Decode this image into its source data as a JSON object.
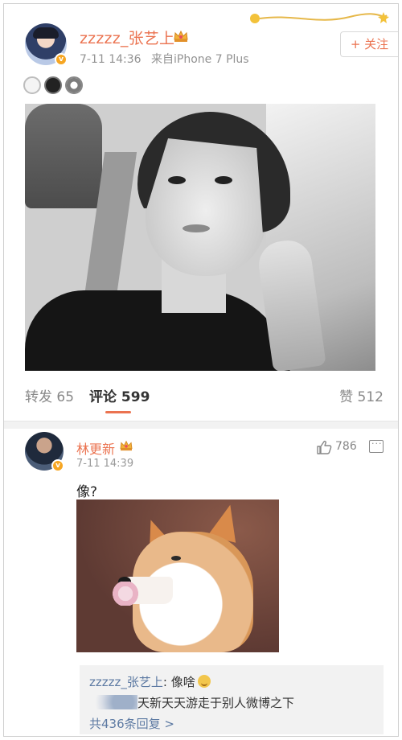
{
  "post": {
    "username": "zzzzz_张艺上",
    "time": "7-11 14:36",
    "source": "来自iPhone 7 Plus",
    "follow_label": "+ 关注"
  },
  "tabs": {
    "repost": "转发 65",
    "comment": "评论 599",
    "like": "赞 512"
  },
  "comment": {
    "username": "林更新",
    "time": "7-11 14:39",
    "likes": "786",
    "text": "像?"
  },
  "replies": {
    "reply1_name": "zzzzz_张艺上",
    "reply1_text": ": 像啥",
    "reply2_text": "天新天天游走于别人微博之下",
    "more": "共436条回复 >"
  },
  "icons": {
    "verified": "verified-badge-icon",
    "crown": "crown-icon",
    "like": "thumbs-up-icon",
    "more": "comment-more-icon"
  },
  "colors": {
    "accent": "#eb7350",
    "link": "#5d7aa3",
    "verified": "#f6a623"
  }
}
